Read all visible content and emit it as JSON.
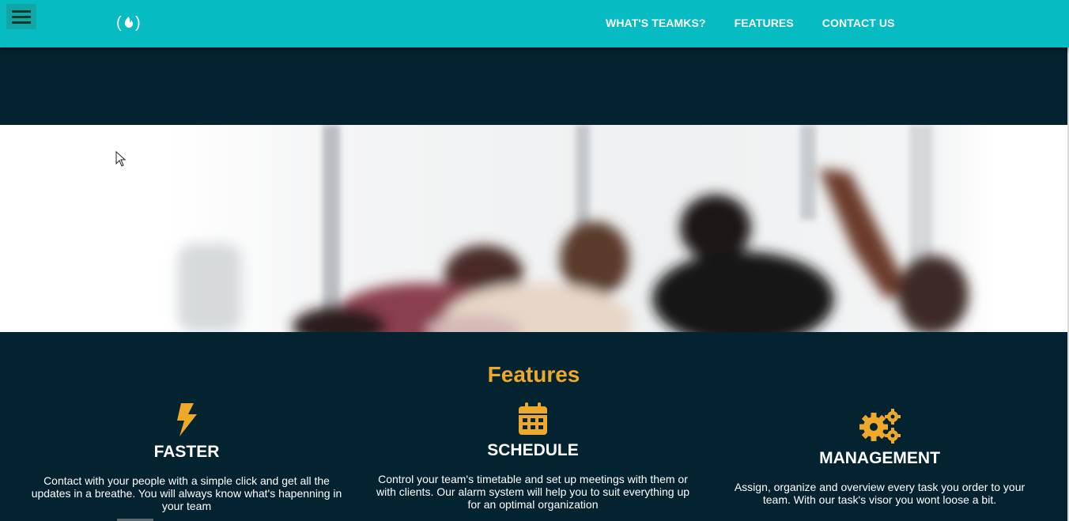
{
  "nav": {
    "menu_icon": "hamburger-menu-icon",
    "logo_icon": "freecodecamp-flame-logo",
    "logo_text": "(🔥)",
    "links": [
      "WHAT'S TEAMKS?",
      "FEATURES",
      "CONTACT US"
    ]
  },
  "colors": {
    "nav_bg": "#06bbc2",
    "dark_bg": "#042331",
    "accent": "#eea92b"
  },
  "hero": {
    "image": "blurred photo of people in an office"
  },
  "features": {
    "title": "Features",
    "items": [
      {
        "icon": "lightning-bolt-icon",
        "title": "FASTER",
        "text": "Contact with your people with a simple click and get all the updates in a breathe. You will always know what's hapenning in your team"
      },
      {
        "icon": "calendar-icon",
        "title": "SCHEDULE",
        "text": "Control your team's timetable and set up meetings with them or with clients. Our alarm system will help you to suit everything up for an optimal organization"
      },
      {
        "icon": "gears-icon",
        "title": "MANAGEMENT",
        "text": "Assign, organize and overview every task you order to your team. With our task's visor you wont loose a bit."
      }
    ]
  }
}
